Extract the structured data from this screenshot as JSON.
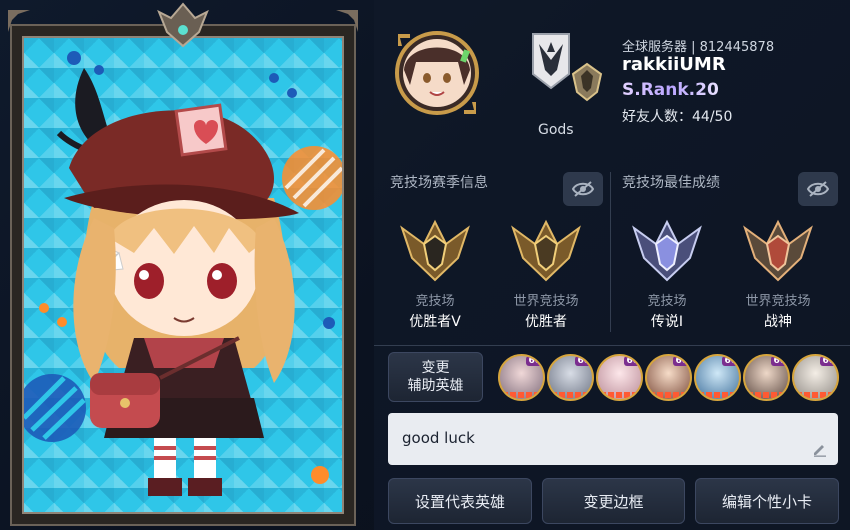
{
  "profile": {
    "server": "全球服务器 | 812445878",
    "player_name": "rakkiiUMR",
    "rank": "S.Rank.20",
    "friends": "好友人数：44/50",
    "guild_name": "Gods"
  },
  "arena_left": {
    "title": "竞技场赛季信息",
    "items": [
      {
        "label": "竞技场",
        "value": "优胜者V"
      },
      {
        "label": "世界竞技场",
        "value": "优胜者"
      }
    ]
  },
  "arena_right": {
    "title": "竞技场最佳成绩",
    "items": [
      {
        "label": "竞技场",
        "value": "传说I"
      },
      {
        "label": "世界竞技场",
        "value": "战神"
      }
    ]
  },
  "support": {
    "button_label_line1": "变更",
    "button_label_line2": "辅助英雄",
    "heroes": [
      {
        "level": "60"
      },
      {
        "level": "60"
      },
      {
        "level": "60"
      },
      {
        "level": "60"
      },
      {
        "level": "60"
      },
      {
        "level": "60"
      },
      {
        "level": "60"
      }
    ]
  },
  "message": {
    "text": "good luck"
  },
  "buttons": {
    "set_hero": "设置代表英雄",
    "change_frame": "变更边框",
    "edit_card": "编辑个性小卡"
  },
  "colors": {
    "card_bg": "#2fc6e8",
    "accent_gold": "#d6a53d",
    "rank_purple": "#b9a4ff"
  },
  "icons": [
    "eye-off-icon",
    "pencil-icon",
    "guild-crest-icon",
    "arena-medal-icon"
  ]
}
